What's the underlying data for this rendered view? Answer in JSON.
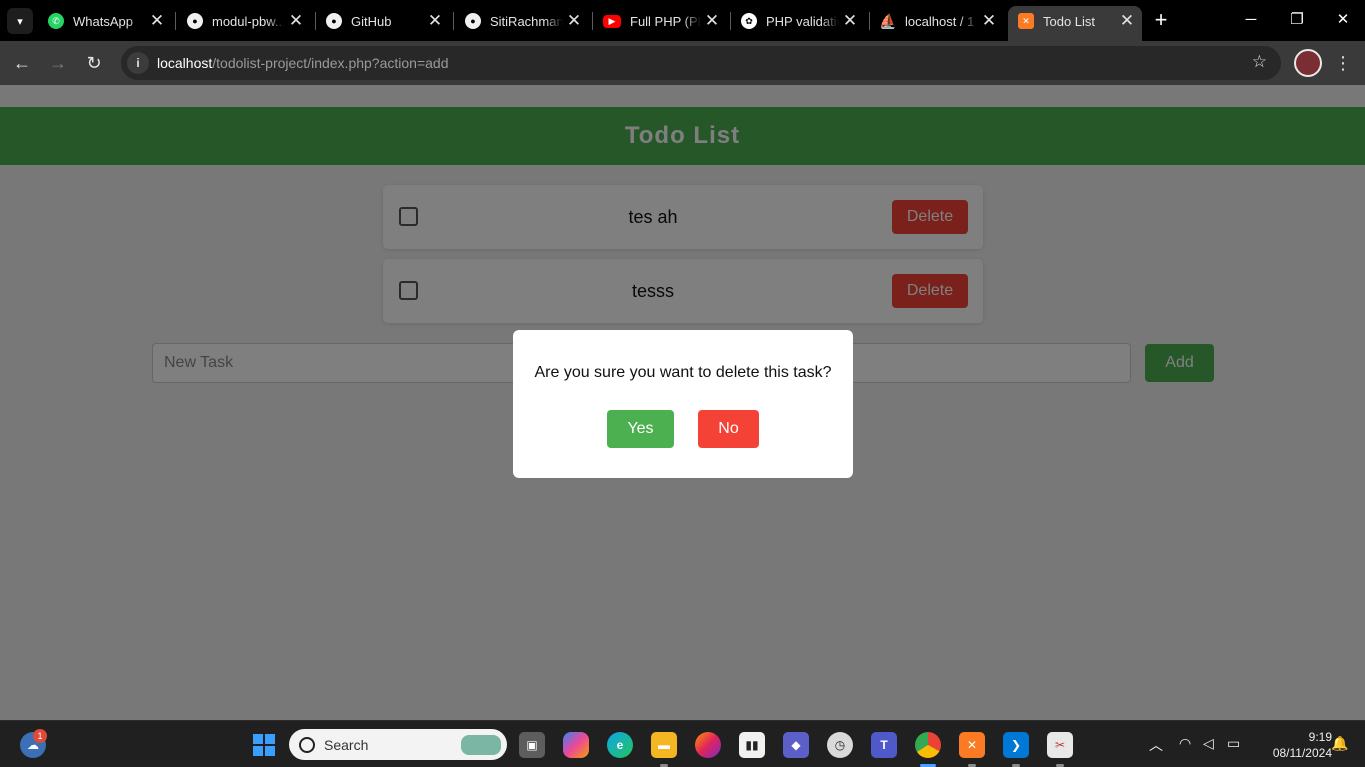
{
  "browser": {
    "tabs": [
      {
        "title": "WhatsApp",
        "icon": "whatsapp-icon",
        "color": "#25d366",
        "active": false
      },
      {
        "title": "modul-pbw...",
        "icon": "github-icon",
        "color": "#24292f",
        "active": false
      },
      {
        "title": "GitHub",
        "icon": "github-icon",
        "color": "#24292f",
        "active": false
      },
      {
        "title": "SitiRachmani",
        "icon": "github-icon",
        "color": "#24292f",
        "active": false
      },
      {
        "title": "Full PHP (PD",
        "icon": "youtube-icon",
        "color": "#ff0000",
        "active": false
      },
      {
        "title": "PHP validatio",
        "icon": "chatgpt-icon",
        "color": "#ffffff",
        "active": false
      },
      {
        "title": "localhost / 1",
        "icon": "phpmyadmin-icon",
        "color": "#f39c12",
        "active": false
      },
      {
        "title": "Todo List",
        "icon": "xampp-icon",
        "color": "#fb7a24",
        "active": true
      }
    ],
    "url_host": "localhost",
    "url_path": "/todolist-project/index.php?action=add"
  },
  "app": {
    "title": "Todo List",
    "todos": [
      {
        "text": "tes ah",
        "delete_label": "Delete",
        "checked": false
      },
      {
        "text": "tesss",
        "delete_label": "Delete",
        "checked": false
      }
    ],
    "new_task_placeholder": "New Task",
    "add_label": "Add"
  },
  "dialog": {
    "message": "Are you sure you want to delete this task?",
    "yes_label": "Yes",
    "no_label": "No"
  },
  "taskbar": {
    "search_label": "Search",
    "notification_count": "1",
    "time": "9:19",
    "date": "08/11/2024"
  },
  "colors": {
    "primary_green": "#4caf50",
    "danger_red": "#f44336"
  }
}
